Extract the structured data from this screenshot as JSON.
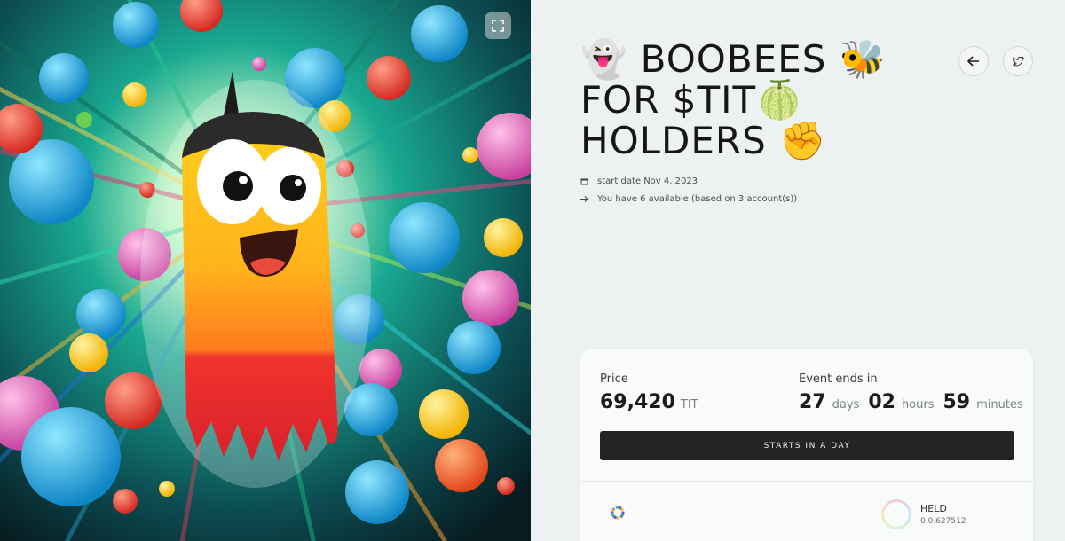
{
  "artwork": {
    "description_icon": "bee-character-artwork",
    "expand_icon": "expand-icon"
  },
  "title": {
    "line1": "👻 BOOBEES 🐝",
    "line2": "FOR $TIT🍈",
    "line3": "HOLDERS ✊"
  },
  "header_buttons": {
    "back_icon": "arrow-left-icon",
    "twitter_icon": "twitter-icon"
  },
  "meta": {
    "start_date": "start date Nov 4, 2023",
    "availability": "You have 6 available (based on 3 account(s))"
  },
  "card": {
    "price_label": "Price",
    "price_value": "69,420",
    "price_unit": "TIT",
    "ends_label": "Event ends in",
    "days_value": "27",
    "days_unit": "days",
    "hours_value": "02",
    "hours_unit": "hours",
    "minutes_value": "59",
    "minutes_unit": "minutes",
    "button_label": "STARTS IN A DAY",
    "held_label": "HELD",
    "held_value": "0.0.627512"
  },
  "colors": {
    "button_bg": "#222426",
    "panel_bg": "#eef1f2",
    "card_bg": "#f9fafa"
  }
}
